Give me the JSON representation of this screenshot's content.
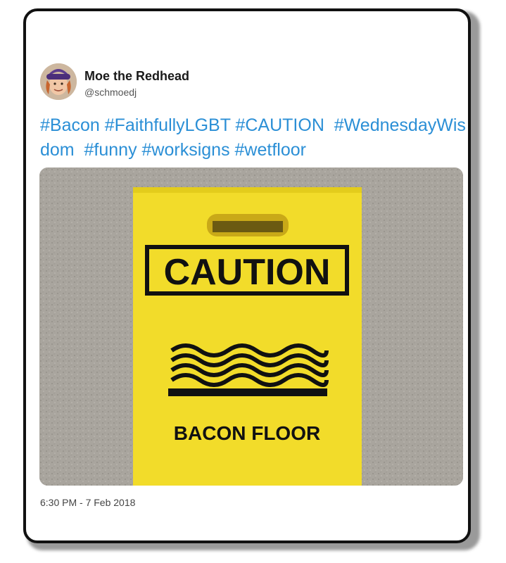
{
  "tweet": {
    "author_name": "Moe the Redhead",
    "author_handle": "@schmoedj",
    "text": "#Bacon #FaithfullyLGBT #CAUTION  #WednesdayWisdom  #funny #worksigns #wetfloor",
    "timestamp": "6:30 PM - 7 Feb 2018"
  },
  "photo": {
    "sign_heading": "CAUTION",
    "sign_caption": "BACON FLOOR",
    "sign_color": "#f2dc2a",
    "floor_color": "#a7a39c"
  },
  "icons": {
    "avatar": "profile-photo",
    "sign_graphic": "wavy-lines-icon"
  }
}
